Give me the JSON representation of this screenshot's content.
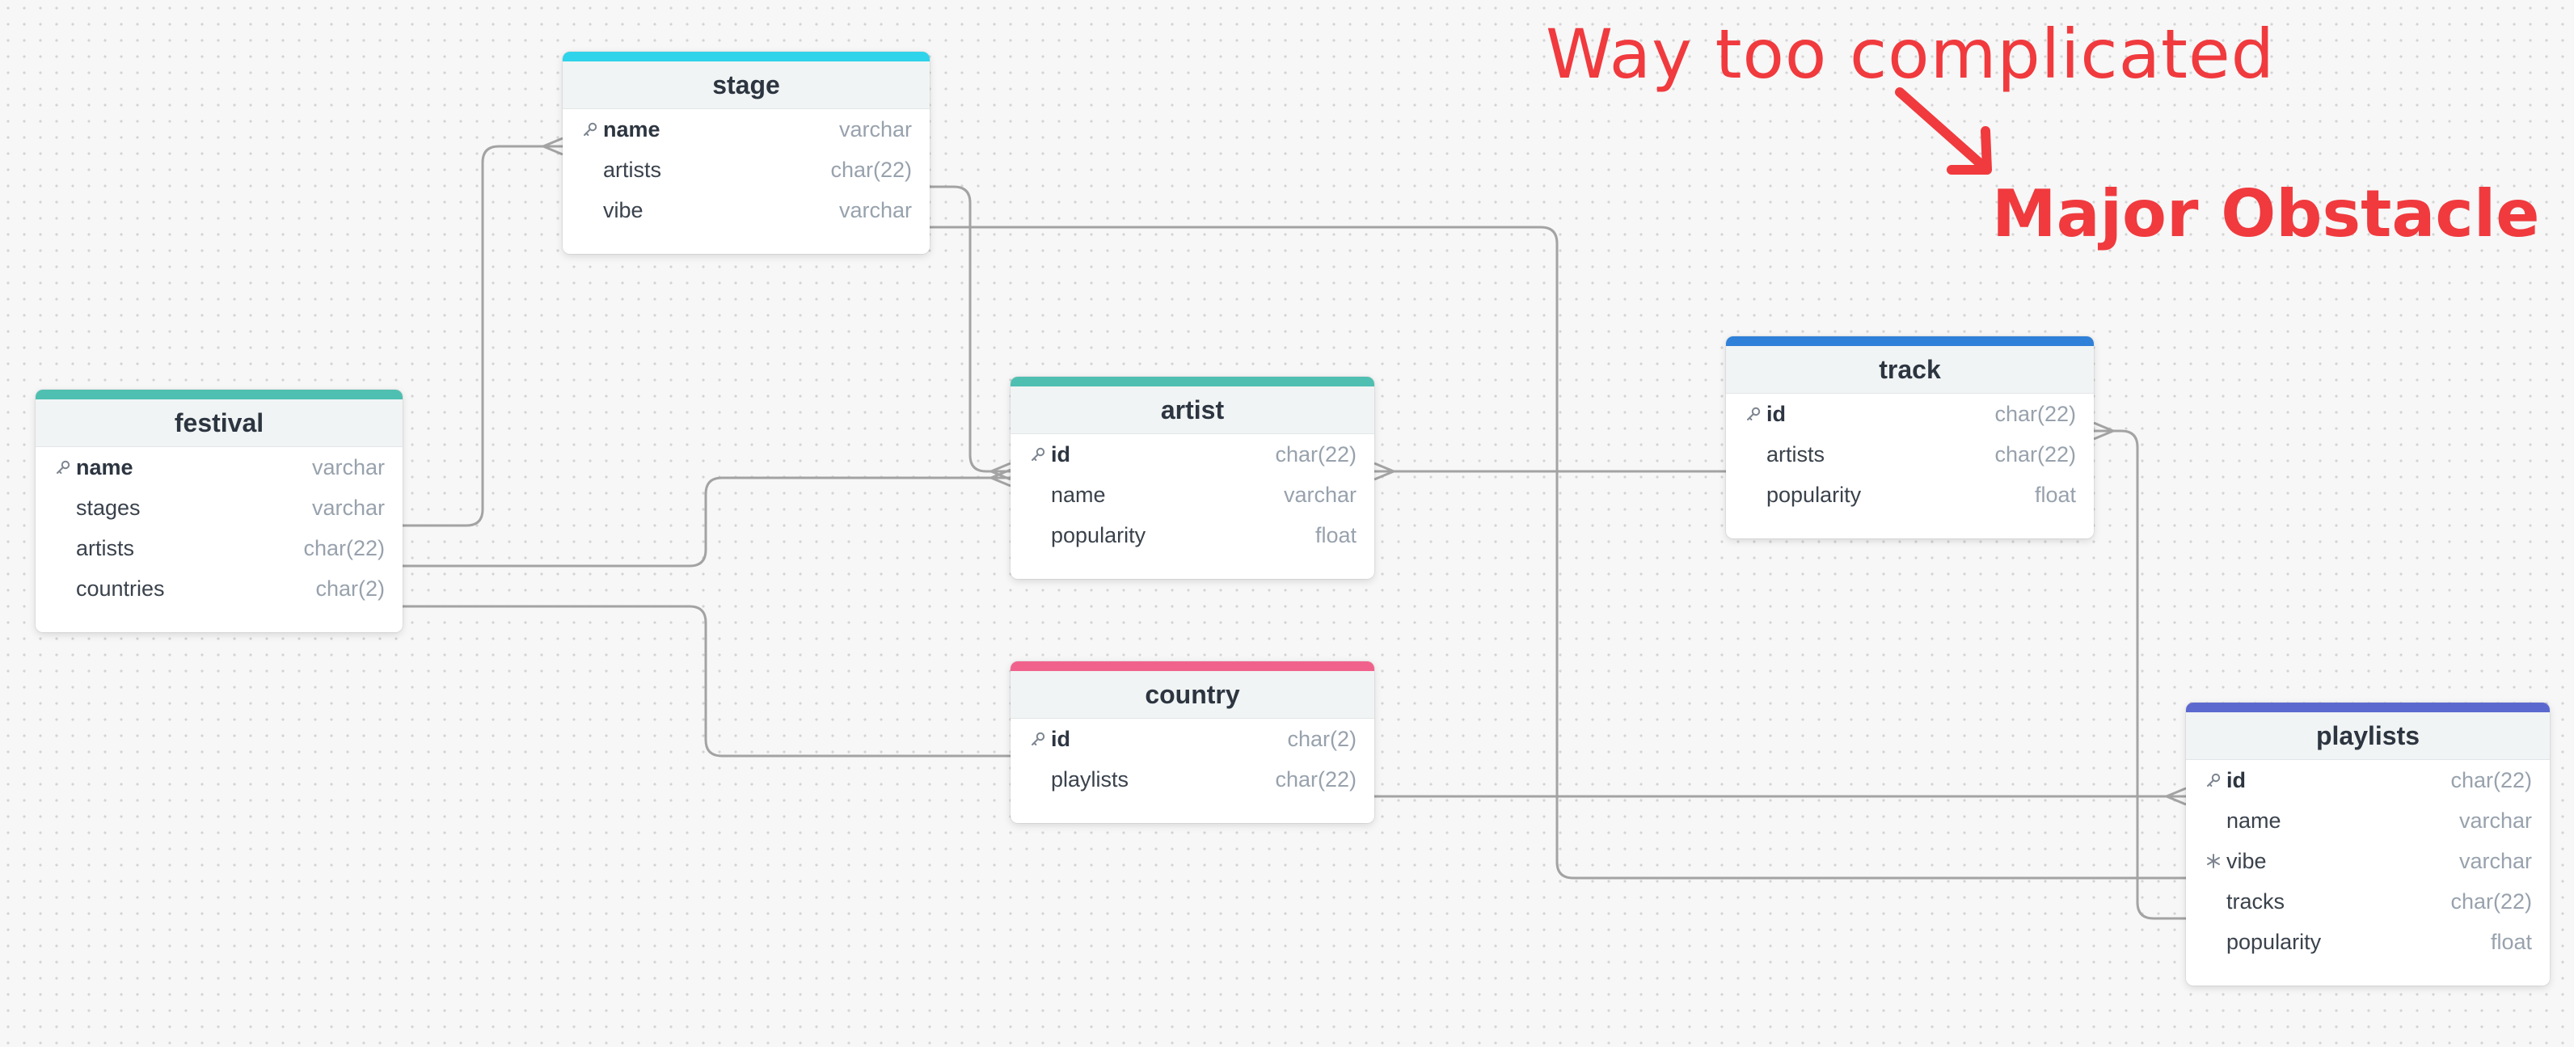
{
  "tables": [
    {
      "id": "stage",
      "title": "stage",
      "accent": "#2fd3ea",
      "columns": [
        {
          "name": "name",
          "type": "varchar",
          "marker": "key",
          "pk": true
        },
        {
          "name": "artists",
          "type": "char(22)",
          "marker": "",
          "pk": false
        },
        {
          "name": "vibe",
          "type": "varchar",
          "marker": "",
          "pk": false
        }
      ]
    },
    {
      "id": "festival",
      "title": "festival",
      "accent": "#4fbfb1",
      "columns": [
        {
          "name": "name",
          "type": "varchar",
          "marker": "key",
          "pk": true
        },
        {
          "name": "stages",
          "type": "varchar",
          "marker": "",
          "pk": false
        },
        {
          "name": "artists",
          "type": "char(22)",
          "marker": "",
          "pk": false
        },
        {
          "name": "countries",
          "type": "char(2)",
          "marker": "",
          "pk": false
        }
      ]
    },
    {
      "id": "artist",
      "title": "artist",
      "accent": "#4fbfb1",
      "columns": [
        {
          "name": "id",
          "type": "char(22)",
          "marker": "key",
          "pk": true
        },
        {
          "name": "name",
          "type": "varchar",
          "marker": "",
          "pk": false
        },
        {
          "name": "popularity",
          "type": "float",
          "marker": "",
          "pk": false
        }
      ]
    },
    {
      "id": "track",
      "title": "track",
      "accent": "#2f80d8",
      "columns": [
        {
          "name": "id",
          "type": "char(22)",
          "marker": "key",
          "pk": true
        },
        {
          "name": "artists",
          "type": "char(22)",
          "marker": "",
          "pk": false
        },
        {
          "name": "popularity",
          "type": "float",
          "marker": "",
          "pk": false
        }
      ]
    },
    {
      "id": "country",
      "title": "country",
      "accent": "#f0628c",
      "columns": [
        {
          "name": "id",
          "type": "char(2)",
          "marker": "key",
          "pk": true
        },
        {
          "name": "playlists",
          "type": "char(22)",
          "marker": "",
          "pk": false
        }
      ]
    },
    {
      "id": "playlists",
      "title": "playlists",
      "accent": "#5b69cf",
      "columns": [
        {
          "name": "id",
          "type": "char(22)",
          "marker": "key",
          "pk": true
        },
        {
          "name": "name",
          "type": "varchar",
          "marker": "",
          "pk": false
        },
        {
          "name": "vibe",
          "type": "varchar",
          "marker": "snowflake",
          "pk": false
        },
        {
          "name": "tracks",
          "type": "char(22)",
          "marker": "",
          "pk": false
        },
        {
          "name": "popularity",
          "type": "float",
          "marker": "",
          "pk": false
        }
      ]
    }
  ],
  "relations": [
    {
      "from": "festival.stages",
      "to": "stage.name",
      "end": "many"
    },
    {
      "from": "stage.artists",
      "to": "artist.id",
      "end": "many"
    },
    {
      "from": "festival.artists",
      "to": "artist.id",
      "end": "many"
    },
    {
      "from": "festival.countries",
      "to": "country.id",
      "end": "one"
    },
    {
      "from": "track.artists",
      "to": "artist.id",
      "end": "many"
    },
    {
      "from": "stage.vibe",
      "to": "playlists.vibe",
      "end": "one"
    },
    {
      "from": "country.playlists",
      "to": "playlists.id",
      "end": "many"
    },
    {
      "from": "playlists.tracks",
      "to": "track.id",
      "end": "many"
    }
  ],
  "annotations": {
    "note": "Way too complicated",
    "label": "Major Obstacle",
    "color": "#f03a3e"
  },
  "icons": {
    "key": "key-icon",
    "snowflake": "snowflake-icon"
  }
}
